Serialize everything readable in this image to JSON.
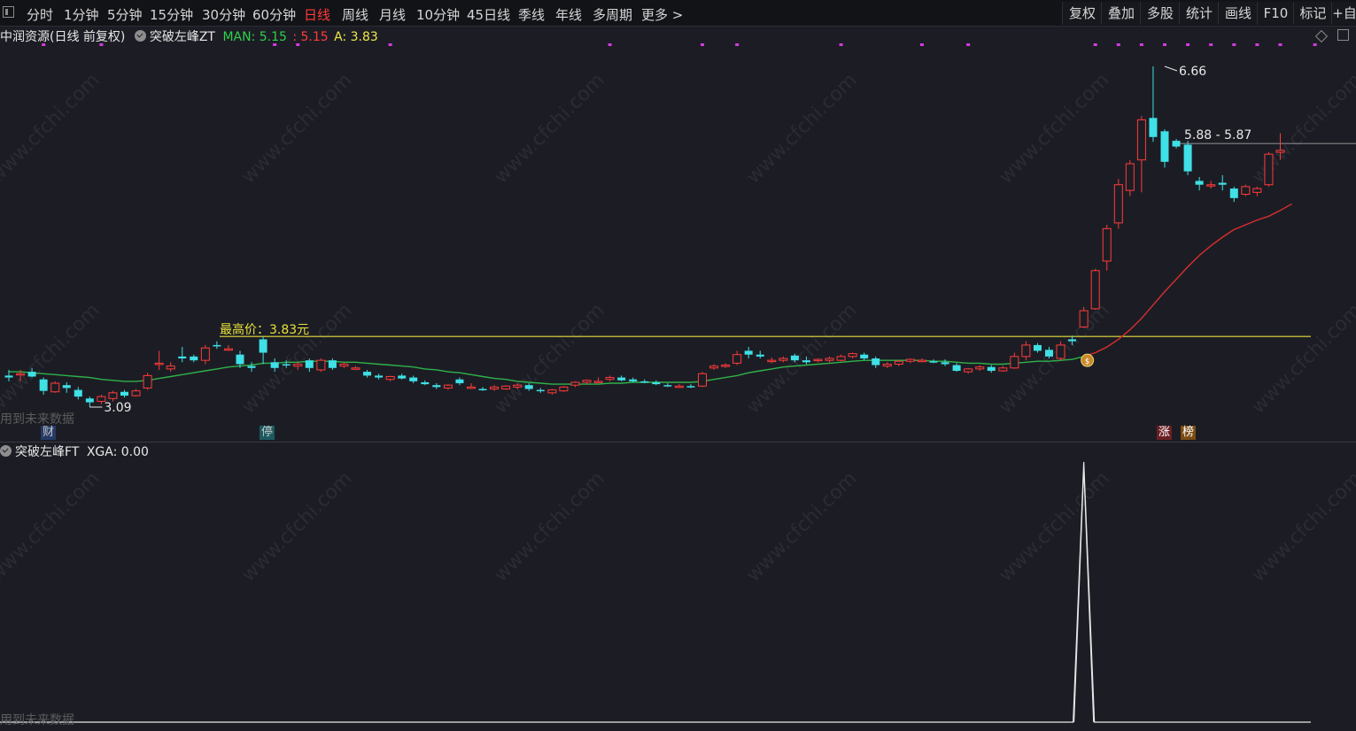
{
  "toolbar": {
    "periods": [
      "分时",
      "1分钟",
      "5分钟",
      "15分钟",
      "30分钟",
      "60分钟",
      "日线",
      "周线",
      "月线",
      "10分钟",
      "45日线",
      "季线",
      "年线",
      "多周期",
      "更多 >"
    ],
    "active_period": "日线",
    "actions": [
      "复权",
      "叠加",
      "多股",
      "统计",
      "画线",
      "F10",
      "标记",
      "+自"
    ]
  },
  "main_legend": {
    "stock_title": "中润资源(日线 前复权)",
    "indicator_name": "突破左峰ZT",
    "man_label": "MAN: 5.15",
    "man2_label": ": 5.15",
    "a_label": "A: 3.83"
  },
  "annotations": {
    "highest_price_label": "最高价：3.83元",
    "peak_label": "6.66",
    "low_label": "3.09",
    "range_label": "5.88 - 5.87",
    "future_data_note": "用到未来数据"
  },
  "tags": {
    "cai": "财",
    "ting": "停",
    "zhang": "涨",
    "bang": "榜"
  },
  "sub_legend": {
    "indicator_name": "突破左峰FT",
    "xga_label": "XGA: 0.00",
    "future_data_note": "用到未来数据"
  },
  "watermark": "www.cfchi.com",
  "colors": {
    "up": "#ff3b3b",
    "down": "#3fe0e6",
    "ma_green": "#2fb24a",
    "ma_red": "#d92e2e",
    "highest_line": "#e8e23a",
    "signal_dot": "#d43be0",
    "man_text": "#2fd14a",
    "a_text": "#f0e64a"
  },
  "chart_data": {
    "type": "candlestick",
    "price_range": [
      2.9,
      7.2
    ],
    "highest_price_line": 3.83,
    "candles": [
      {
        "o": 3.42,
        "h": 3.48,
        "l": 3.36,
        "c": 3.4
      },
      {
        "o": 3.44,
        "h": 3.48,
        "l": 3.36,
        "c": 3.44
      },
      {
        "o": 3.46,
        "h": 3.5,
        "l": 3.4,
        "c": 3.41
      },
      {
        "o": 3.38,
        "h": 3.4,
        "l": 3.22,
        "c": 3.26
      },
      {
        "o": 3.25,
        "h": 3.36,
        "l": 3.24,
        "c": 3.34
      },
      {
        "o": 3.32,
        "h": 3.35,
        "l": 3.24,
        "c": 3.29
      },
      {
        "o": 3.27,
        "h": 3.3,
        "l": 3.17,
        "c": 3.2
      },
      {
        "o": 3.18,
        "h": 3.2,
        "l": 3.09,
        "c": 3.14
      },
      {
        "o": 3.15,
        "h": 3.22,
        "l": 3.12,
        "c": 3.2
      },
      {
        "o": 3.18,
        "h": 3.26,
        "l": 3.15,
        "c": 3.24
      },
      {
        "o": 3.25,
        "h": 3.27,
        "l": 3.19,
        "c": 3.21
      },
      {
        "o": 3.21,
        "h": 3.28,
        "l": 3.2,
        "c": 3.26
      },
      {
        "o": 3.29,
        "h": 3.45,
        "l": 3.27,
        "c": 3.42
      },
      {
        "o": 3.55,
        "h": 3.68,
        "l": 3.48,
        "c": 3.55
      },
      {
        "o": 3.49,
        "h": 3.56,
        "l": 3.46,
        "c": 3.52
      },
      {
        "o": 3.62,
        "h": 3.72,
        "l": 3.56,
        "c": 3.6
      },
      {
        "o": 3.62,
        "h": 3.64,
        "l": 3.56,
        "c": 3.58
      },
      {
        "o": 3.58,
        "h": 3.74,
        "l": 3.54,
        "c": 3.71
      },
      {
        "o": 3.74,
        "h": 3.78,
        "l": 3.7,
        "c": 3.73
      },
      {
        "o": 3.7,
        "h": 3.74,
        "l": 3.68,
        "c": 3.7
      },
      {
        "o": 3.64,
        "h": 3.68,
        "l": 3.5,
        "c": 3.54
      },
      {
        "o": 3.52,
        "h": 3.56,
        "l": 3.46,
        "c": 3.5
      },
      {
        "o": 3.8,
        "h": 3.83,
        "l": 3.54,
        "c": 3.66
      },
      {
        "o": 3.56,
        "h": 3.6,
        "l": 3.46,
        "c": 3.5
      },
      {
        "o": 3.54,
        "h": 3.58,
        "l": 3.5,
        "c": 3.53
      },
      {
        "o": 3.52,
        "h": 3.56,
        "l": 3.48,
        "c": 3.54
      },
      {
        "o": 3.58,
        "h": 3.6,
        "l": 3.46,
        "c": 3.5
      },
      {
        "o": 3.48,
        "h": 3.6,
        "l": 3.46,
        "c": 3.58
      },
      {
        "o": 3.58,
        "h": 3.6,
        "l": 3.48,
        "c": 3.5
      },
      {
        "o": 3.52,
        "h": 3.56,
        "l": 3.5,
        "c": 3.54
      },
      {
        "o": 3.5,
        "h": 3.52,
        "l": 3.48,
        "c": 3.5
      },
      {
        "o": 3.46,
        "h": 3.48,
        "l": 3.4,
        "c": 3.42
      },
      {
        "o": 3.42,
        "h": 3.44,
        "l": 3.38,
        "c": 3.4
      },
      {
        "o": 3.38,
        "h": 3.42,
        "l": 3.36,
        "c": 3.41
      },
      {
        "o": 3.42,
        "h": 3.44,
        "l": 3.38,
        "c": 3.39
      },
      {
        "o": 3.4,
        "h": 3.42,
        "l": 3.34,
        "c": 3.36
      },
      {
        "o": 3.35,
        "h": 3.37,
        "l": 3.32,
        "c": 3.33
      },
      {
        "o": 3.32,
        "h": 3.34,
        "l": 3.28,
        "c": 3.3
      },
      {
        "o": 3.29,
        "h": 3.33,
        "l": 3.27,
        "c": 3.32
      },
      {
        "o": 3.38,
        "h": 3.4,
        "l": 3.32,
        "c": 3.34
      },
      {
        "o": 3.3,
        "h": 3.34,
        "l": 3.28,
        "c": 3.3
      },
      {
        "o": 3.28,
        "h": 3.3,
        "l": 3.26,
        "c": 3.27
      },
      {
        "o": 3.28,
        "h": 3.32,
        "l": 3.26,
        "c": 3.3
      },
      {
        "o": 3.28,
        "h": 3.32,
        "l": 3.27,
        "c": 3.31
      },
      {
        "o": 3.3,
        "h": 3.34,
        "l": 3.28,
        "c": 3.32
      },
      {
        "o": 3.32,
        "h": 3.34,
        "l": 3.26,
        "c": 3.28
      },
      {
        "o": 3.27,
        "h": 3.29,
        "l": 3.24,
        "c": 3.26
      },
      {
        "o": 3.24,
        "h": 3.28,
        "l": 3.22,
        "c": 3.27
      },
      {
        "o": 3.26,
        "h": 3.31,
        "l": 3.25,
        "c": 3.3
      },
      {
        "o": 3.32,
        "h": 3.36,
        "l": 3.3,
        "c": 3.35
      },
      {
        "o": 3.35,
        "h": 3.38,
        "l": 3.33,
        "c": 3.37
      },
      {
        "o": 3.36,
        "h": 3.4,
        "l": 3.34,
        "c": 3.36
      },
      {
        "o": 3.38,
        "h": 3.42,
        "l": 3.36,
        "c": 3.4
      },
      {
        "o": 3.4,
        "h": 3.42,
        "l": 3.36,
        "c": 3.37
      },
      {
        "o": 3.38,
        "h": 3.4,
        "l": 3.35,
        "c": 3.36
      },
      {
        "o": 3.36,
        "h": 3.38,
        "l": 3.34,
        "c": 3.35
      },
      {
        "o": 3.35,
        "h": 3.37,
        "l": 3.32,
        "c": 3.33
      },
      {
        "o": 3.32,
        "h": 3.34,
        "l": 3.3,
        "c": 3.31
      },
      {
        "o": 3.3,
        "h": 3.33,
        "l": 3.29,
        "c": 3.31
      },
      {
        "o": 3.31,
        "h": 3.33,
        "l": 3.29,
        "c": 3.3
      },
      {
        "o": 3.31,
        "h": 3.46,
        "l": 3.3,
        "c": 3.44
      },
      {
        "o": 3.5,
        "h": 3.54,
        "l": 3.48,
        "c": 3.52
      },
      {
        "o": 3.52,
        "h": 3.55,
        "l": 3.5,
        "c": 3.53
      },
      {
        "o": 3.55,
        "h": 3.68,
        "l": 3.53,
        "c": 3.64
      },
      {
        "o": 3.68,
        "h": 3.72,
        "l": 3.6,
        "c": 3.64
      },
      {
        "o": 3.64,
        "h": 3.68,
        "l": 3.6,
        "c": 3.62
      },
      {
        "o": 3.58,
        "h": 3.61,
        "l": 3.55,
        "c": 3.58
      },
      {
        "o": 3.58,
        "h": 3.62,
        "l": 3.56,
        "c": 3.6
      },
      {
        "o": 3.63,
        "h": 3.65,
        "l": 3.56,
        "c": 3.58
      },
      {
        "o": 3.58,
        "h": 3.62,
        "l": 3.54,
        "c": 3.56
      },
      {
        "o": 3.58,
        "h": 3.6,
        "l": 3.56,
        "c": 3.59
      },
      {
        "o": 3.58,
        "h": 3.62,
        "l": 3.56,
        "c": 3.6
      },
      {
        "o": 3.58,
        "h": 3.64,
        "l": 3.57,
        "c": 3.62
      },
      {
        "o": 3.62,
        "h": 3.66,
        "l": 3.6,
        "c": 3.65
      },
      {
        "o": 3.64,
        "h": 3.66,
        "l": 3.58,
        "c": 3.6
      },
      {
        "o": 3.6,
        "h": 3.62,
        "l": 3.5,
        "c": 3.53
      },
      {
        "o": 3.52,
        "h": 3.56,
        "l": 3.5,
        "c": 3.54
      },
      {
        "o": 3.54,
        "h": 3.58,
        "l": 3.52,
        "c": 3.57
      },
      {
        "o": 3.57,
        "h": 3.6,
        "l": 3.55,
        "c": 3.59
      },
      {
        "o": 3.58,
        "h": 3.6,
        "l": 3.56,
        "c": 3.58
      },
      {
        "o": 3.57,
        "h": 3.59,
        "l": 3.55,
        "c": 3.56
      },
      {
        "o": 3.56,
        "h": 3.59,
        "l": 3.52,
        "c": 3.54
      },
      {
        "o": 3.53,
        "h": 3.55,
        "l": 3.46,
        "c": 3.47
      },
      {
        "o": 3.46,
        "h": 3.5,
        "l": 3.44,
        "c": 3.49
      },
      {
        "o": 3.49,
        "h": 3.53,
        "l": 3.47,
        "c": 3.51
      },
      {
        "o": 3.51,
        "h": 3.53,
        "l": 3.45,
        "c": 3.47
      },
      {
        "o": 3.47,
        "h": 3.52,
        "l": 3.46,
        "c": 3.5
      },
      {
        "o": 3.5,
        "h": 3.66,
        "l": 3.49,
        "c": 3.62
      },
      {
        "o": 3.62,
        "h": 3.78,
        "l": 3.58,
        "c": 3.74
      },
      {
        "o": 3.74,
        "h": 3.76,
        "l": 3.66,
        "c": 3.68
      },
      {
        "o": 3.69,
        "h": 3.72,
        "l": 3.6,
        "c": 3.62
      },
      {
        "o": 3.6,
        "h": 3.78,
        "l": 3.58,
        "c": 3.74
      },
      {
        "o": 3.8,
        "h": 3.84,
        "l": 3.74,
        "c": 3.78
      },
      {
        "o": 3.93,
        "h": 4.14,
        "l": 3.92,
        "c": 4.1
      },
      {
        "o": 4.12,
        "h": 4.54,
        "l": 4.11,
        "c": 4.52
      },
      {
        "o": 4.62,
        "h": 5.0,
        "l": 4.52,
        "c": 4.96
      },
      {
        "o": 5.02,
        "h": 5.48,
        "l": 4.96,
        "c": 5.42
      },
      {
        "o": 5.36,
        "h": 5.68,
        "l": 5.3,
        "c": 5.64
      },
      {
        "o": 5.68,
        "h": 6.14,
        "l": 5.34,
        "c": 6.1
      },
      {
        "o": 6.12,
        "h": 6.66,
        "l": 5.87,
        "c": 5.92
      },
      {
        "o": 5.98,
        "h": 6.0,
        "l": 5.6,
        "c": 5.66
      },
      {
        "o": 5.88,
        "h": 5.9,
        "l": 5.8,
        "c": 5.82
      },
      {
        "o": 5.84,
        "h": 5.88,
        "l": 5.52,
        "c": 5.56
      },
      {
        "o": 5.46,
        "h": 5.5,
        "l": 5.36,
        "c": 5.42
      },
      {
        "o": 5.42,
        "h": 5.46,
        "l": 5.38,
        "c": 5.42
      },
      {
        "o": 5.44,
        "h": 5.52,
        "l": 5.36,
        "c": 5.42
      },
      {
        "o": 5.38,
        "h": 5.4,
        "l": 5.24,
        "c": 5.28
      },
      {
        "o": 5.32,
        "h": 5.42,
        "l": 5.3,
        "c": 5.4
      },
      {
        "o": 5.34,
        "h": 5.4,
        "l": 5.3,
        "c": 5.38
      },
      {
        "o": 5.42,
        "h": 5.76,
        "l": 5.4,
        "c": 5.74
      },
      {
        "o": 5.76,
        "h": 5.96,
        "l": 5.68,
        "c": 5.78
      }
    ],
    "moving_average": [
      3.46,
      3.46,
      3.45,
      3.44,
      3.43,
      3.42,
      3.41,
      3.4,
      3.38,
      3.37,
      3.36,
      3.36,
      3.37,
      3.39,
      3.41,
      3.43,
      3.45,
      3.47,
      3.49,
      3.51,
      3.52,
      3.53,
      3.55,
      3.55,
      3.56,
      3.56,
      3.57,
      3.57,
      3.57,
      3.56,
      3.56,
      3.55,
      3.54,
      3.53,
      3.52,
      3.51,
      3.49,
      3.48,
      3.46,
      3.45,
      3.43,
      3.41,
      3.39,
      3.38,
      3.36,
      3.35,
      3.34,
      3.33,
      3.33,
      3.33,
      3.33,
      3.33,
      3.34,
      3.34,
      3.35,
      3.35,
      3.35,
      3.35,
      3.35,
      3.35,
      3.36,
      3.38,
      3.4,
      3.42,
      3.45,
      3.47,
      3.49,
      3.51,
      3.52,
      3.53,
      3.54,
      3.55,
      3.56,
      3.57,
      3.58,
      3.58,
      3.58,
      3.58,
      3.58,
      3.58,
      3.57,
      3.57,
      3.56,
      3.55,
      3.55,
      3.54,
      3.54,
      3.55,
      3.56,
      3.57,
      3.57,
      3.58,
      3.59,
      3.62,
      3.66,
      3.72,
      3.8,
      3.9,
      4.02,
      4.16,
      4.3,
      4.43,
      4.56,
      4.68,
      4.78,
      4.87,
      4.95,
      5.0,
      5.05,
      5.09,
      5.15,
      5.22
    ],
    "ma_red_from_index": 93,
    "xga_signal_index": 93,
    "signal_dot_indices": [
      3,
      8,
      23,
      25,
      33,
      52,
      60,
      63,
      72,
      79,
      83,
      94,
      96,
      98,
      100,
      102,
      104,
      106,
      108,
      110,
      113
    ]
  }
}
